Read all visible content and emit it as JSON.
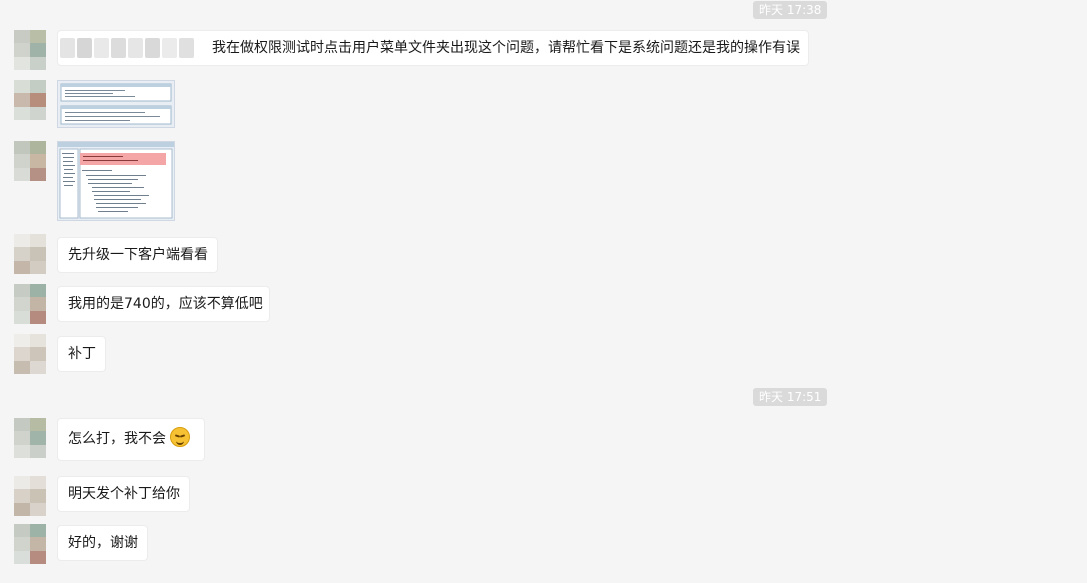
{
  "timestamps": [
    "昨天 17:38",
    "昨天 17:51"
  ],
  "messages": [
    {
      "text": "我在做权限测试时点击用户菜单文件夹出现这个问题，请帮忙看下是系统问题还是我的操作有误"
    },
    {
      "image": "screenshot-thumbnail"
    },
    {
      "image": "screenshot-thumbnail"
    },
    {
      "text": "先升级一下客户端看看"
    },
    {
      "text": "我用的是740的，应该不算低吧"
    },
    {
      "text": "补丁"
    },
    {
      "text": "怎么打，我不会",
      "emoji": "grinning-sweat-emoji"
    },
    {
      "text": "明天发个补丁给你"
    },
    {
      "text": "好的，谢谢"
    }
  ],
  "colors": {
    "background": "#f5f5f5",
    "bubble": "#ffffff",
    "timestamp": "#dadada",
    "error_highlight": "#f4a6a6"
  }
}
